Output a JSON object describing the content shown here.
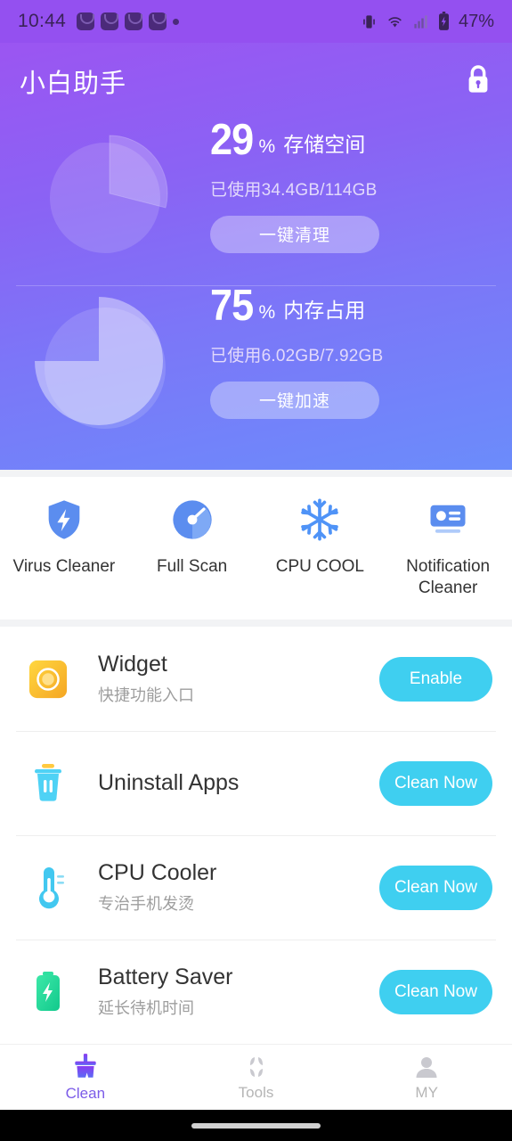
{
  "statusbar": {
    "time": "10:44",
    "battery_percent": "47%",
    "notification_icons": [
      "app-badge-icon",
      "app-badge-icon",
      "app-badge-icon",
      "app-badge-icon",
      "dot-icon"
    ],
    "right_icons": [
      "vibrate-icon",
      "wifi-icon",
      "signal-icon",
      "battery-charging-icon"
    ]
  },
  "header": {
    "app_title": "小白助手",
    "lock_icon": "lock-icon",
    "accent_start": "#9B55F2",
    "accent_end": "#6B8CFB",
    "panels": [
      {
        "id": "storage",
        "percent": "29",
        "percent_sign": "%",
        "label": "存储空间",
        "usage": "已使用34.4GB/114GB",
        "button": "一键清理",
        "pie_value": 29
      },
      {
        "id": "memory",
        "percent": "75",
        "percent_sign": "%",
        "label": "内存占用",
        "usage": "已使用6.02GB/7.92GB",
        "button": "一键加速",
        "pie_value": 75
      }
    ]
  },
  "quick_actions": [
    {
      "label": "Virus Cleaner",
      "icon": "shield-bolt-icon"
    },
    {
      "label": "Full Scan",
      "icon": "radar-scan-icon"
    },
    {
      "label": "CPU COOL",
      "icon": "snowflake-icon"
    },
    {
      "label": "Notification Cleaner",
      "icon": "notification-card-icon"
    }
  ],
  "features": [
    {
      "title": "Widget",
      "subtitle": "快捷功能入口",
      "button": "Enable",
      "icon": "widget-icon"
    },
    {
      "title": "Uninstall Apps",
      "subtitle": "",
      "button": "Clean Now",
      "icon": "trash-icon"
    },
    {
      "title": "CPU Cooler",
      "subtitle": "专治手机发烫",
      "button": "Clean Now",
      "icon": "thermometer-icon"
    },
    {
      "title": "Battery Saver",
      "subtitle": "延长待机时间",
      "button": "Clean Now",
      "icon": "battery-bolt-icon"
    }
  ],
  "bottom_nav": {
    "active_color": "#7B5BE8",
    "items": [
      {
        "label": "Clean",
        "icon": "broom-icon",
        "active": true
      },
      {
        "label": "Tools",
        "icon": "grid-petals-icon",
        "active": false
      },
      {
        "label": "MY",
        "icon": "person-icon",
        "active": false
      }
    ]
  }
}
